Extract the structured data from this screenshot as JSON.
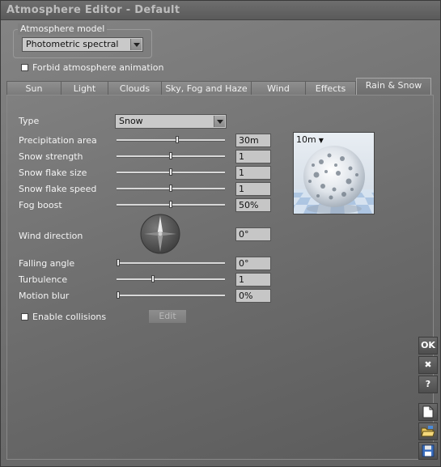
{
  "window": {
    "title": "Atmosphere Editor - Default"
  },
  "model": {
    "group_label": "Atmosphere model",
    "selected": "Photometric spectral",
    "forbid_animation_label": "Forbid atmosphere animation",
    "forbid_animation_checked": false
  },
  "tabs": [
    {
      "label": "Sun",
      "active": false
    },
    {
      "label": "Light",
      "active": false
    },
    {
      "label": "Clouds",
      "active": false
    },
    {
      "label": "Sky, Fog and Haze",
      "active": false
    },
    {
      "label": "Wind",
      "active": false
    },
    {
      "label": "Effects",
      "active": false
    },
    {
      "label": "Rain & Snow",
      "active": true
    }
  ],
  "rain_snow": {
    "type_label": "Type",
    "type_value": "Snow",
    "preview_distance": "10m",
    "sliders": [
      {
        "label": "Precipitation area",
        "value": "30m",
        "level": 0.56
      },
      {
        "label": "Snow strength",
        "value": "1",
        "level": 0.5
      },
      {
        "label": "Snow flake size",
        "value": "1",
        "level": 0.5
      },
      {
        "label": "Snow flake speed",
        "value": "1",
        "level": 0.5
      },
      {
        "label": "Fog boost",
        "value": "50%",
        "level": 0.5
      }
    ],
    "wind_direction_label": "Wind direction",
    "wind_direction_value": "0°",
    "sliders2": [
      {
        "label": "Falling angle",
        "value": "0°",
        "level": 0.0
      },
      {
        "label": "Turbulence",
        "value": "1",
        "level": 0.33
      },
      {
        "label": "Motion blur",
        "value": "0%",
        "level": 0.0
      }
    ],
    "enable_collisions_label": "Enable collisions",
    "enable_collisions_checked": false,
    "edit_label": "Edit"
  },
  "side_buttons": {
    "ok": "OK",
    "cancel": "✖",
    "help": "?"
  },
  "icons": [
    "dropdown-arrow-icon",
    "compass-icon",
    "close-icon",
    "help-icon",
    "new-document-icon",
    "open-folder-icon",
    "save-disk-icon"
  ]
}
